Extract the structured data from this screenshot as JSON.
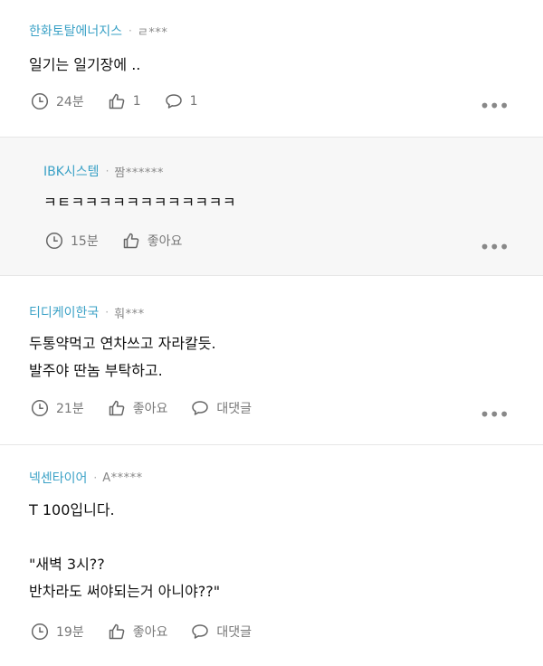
{
  "comments": [
    {
      "company": "한화토탈에너지스",
      "user": "ㄹ***",
      "body": "일기는 일기장에 ..",
      "time": "24분",
      "like": "1",
      "reply": "1"
    },
    {
      "company": "IBK시스템",
      "user": "짬******",
      "body": "ㅋㅌㅋㅋㅋㅋㅋㅋㅋㅋㅋㅋㅋㅋ",
      "time": "15분",
      "like": "좋아요"
    },
    {
      "company": "티디케이한국",
      "user": "훠***",
      "body": "두통약먹고 연차쓰고 자라칼듯.\n발주야 딴놈 부탁하고.",
      "time": "21분",
      "like": "좋아요",
      "reply": "대댓글"
    },
    {
      "company": "넥센타이어",
      "user": "A*****",
      "body": "T 100입니다.\n\n\"새벽 3시??\n반차라도 써야되는거 아니야??\"",
      "time": "19분",
      "like": "좋아요",
      "reply": "대댓글"
    }
  ],
  "icons": {
    "time": "clock-icon",
    "like": "thumbs-up-icon",
    "reply": "speech-bubble-icon",
    "more": "more-options-icon"
  },
  "colors": {
    "company": "#3aa1c6",
    "reply_background": "#f7f7f7"
  }
}
